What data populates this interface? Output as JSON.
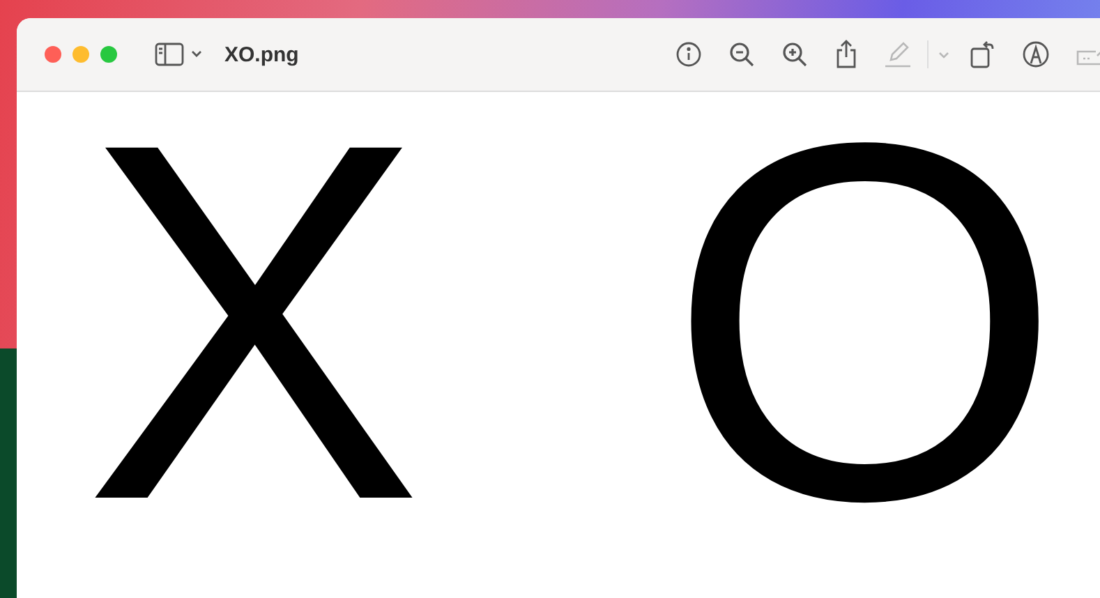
{
  "window": {
    "title": "XO.png"
  },
  "toolbar": [
    {
      "kind": "info",
      "disabled": false
    },
    {
      "kind": "zoom-out",
      "disabled": false
    },
    {
      "kind": "zoom-in",
      "disabled": false
    },
    {
      "kind": "share",
      "disabled": false
    },
    {
      "kind": "highlight",
      "disabled": true
    },
    {
      "kind": "chevron",
      "disabled": true
    },
    {
      "kind": "rotate",
      "disabled": false
    },
    {
      "kind": "markup",
      "disabled": false
    },
    {
      "kind": "form",
      "disabled": true
    }
  ],
  "image": {
    "letters": [
      "X",
      "O"
    ]
  }
}
